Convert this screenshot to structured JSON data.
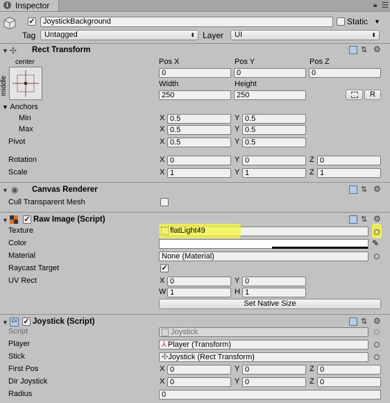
{
  "tab": {
    "title": "Inspector"
  },
  "object": {
    "name": "JoystickBackground",
    "static_label": "Static",
    "tag_label": "Tag",
    "tag_value": "Untagged",
    "layer_label": "Layer",
    "layer_value": "UI"
  },
  "rect_transform": {
    "title": "Rect Transform",
    "anchor_h": "center",
    "anchor_v": "middle",
    "pos_x_label": "Pos X",
    "pos_y_label": "Pos Y",
    "pos_z_label": "Pos Z",
    "pos_x": "0",
    "pos_y": "0",
    "pos_z": "0",
    "width_label": "Width",
    "height_label": "Height",
    "width": "250",
    "height": "250",
    "r_button": "R",
    "anchors_label": "Anchors",
    "min_label": "Min",
    "max_label": "Max",
    "min_x": "0.5",
    "min_y": "0.5",
    "max_x": "0.5",
    "max_y": "0.5",
    "pivot_label": "Pivot",
    "pivot_x": "0.5",
    "pivot_y": "0.5",
    "rotation_label": "Rotation",
    "rot_x": "0",
    "rot_y": "0",
    "rot_z": "0",
    "scale_label": "Scale",
    "scale_x": "1",
    "scale_y": "1",
    "scale_z": "1"
  },
  "axis": {
    "x": "X",
    "y": "Y",
    "z": "Z",
    "w": "W",
    "h": "H"
  },
  "canvas_renderer": {
    "title": "Canvas Renderer",
    "cull_label": "Cull Transparent Mesh"
  },
  "raw_image": {
    "title": "Raw Image (Script)",
    "texture_label": "Texture",
    "texture_value": "flatLight49",
    "color_label": "Color",
    "material_label": "Material",
    "material_value": "None (Material)",
    "raycast_label": "Raycast Target",
    "uvrect_label": "UV Rect",
    "uv_x": "0",
    "uv_y": "0",
    "uv_w": "1",
    "uv_h": "1",
    "native_size_button": "Set Native Size"
  },
  "joystick": {
    "title": "Joystick (Script)",
    "script_label": "Script",
    "script_value": "Joystick",
    "player_label": "Player",
    "player_value": "Player (Transform)",
    "stick_label": "Stick",
    "stick_value": "Joystick (Rect Transform)",
    "firstpos_label": "First Pos",
    "fp_x": "0",
    "fp_y": "0",
    "fp_z": "0",
    "dirjoy_label": "Dir Joystick",
    "dj_x": "0",
    "dj_y": "0",
    "dj_z": "0",
    "radius_label": "Radius",
    "radius_value": "0"
  },
  "colors": {
    "highlight": "#f7f740",
    "panel": "#c2c2c2"
  }
}
